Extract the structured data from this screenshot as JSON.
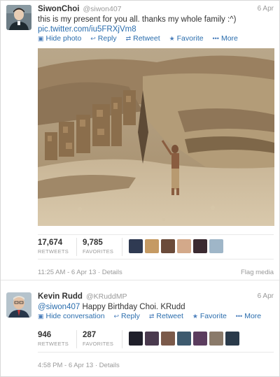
{
  "tweets": [
    {
      "name": "SiwonChoi",
      "handle": "@siwon407",
      "date": "6 Apr",
      "text": "this is my present for you all. thanks my whole family :^)",
      "link": "pic.twitter.com/iu5FRXjVm8",
      "actions": {
        "hide": "Hide photo",
        "reply": "Reply",
        "retweet": "Retweet",
        "favorite": "Favorite",
        "more": "More"
      },
      "retweets": "17,674",
      "retweets_label": "RETWEETS",
      "favorites": "9,785",
      "favorites_label": "FAVORITES",
      "timestamp": "11:25 AM - 6 Apr 13",
      "details": "Details",
      "flag": "Flag media",
      "icons": {
        "hide": "image-icon",
        "reply": "reply-arrow-icon",
        "retweet": "retweet-icon",
        "favorite": "star-icon",
        "more": "ellipsis-icon"
      }
    },
    {
      "name": "Kevin Rudd",
      "handle": "@KRuddMP",
      "date": "6 Apr",
      "mention": "@siwon407",
      "text": " Happy Birthday Choi. KRudd",
      "actions": {
        "hide": "Hide conversation",
        "reply": "Reply",
        "retweet": "Retweet",
        "favorite": "Favorite",
        "more": "More"
      },
      "retweets": "946",
      "retweets_label": "RETWEETS",
      "favorites": "287",
      "favorites_label": "FAVORITES",
      "timestamp": "4:58 PM - 6 Apr 13",
      "details": "Details"
    }
  ],
  "colors": {
    "link": "#2a6dad",
    "muted": "#999999",
    "text": "#333333"
  }
}
